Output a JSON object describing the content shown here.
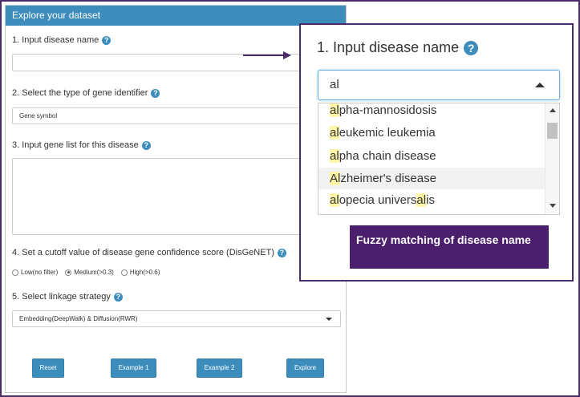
{
  "panel": {
    "header": "Explore your dataset",
    "disease_label": "1. Input disease name",
    "disease_value": "",
    "identifier_label": "2. Select the type of gene identifier",
    "identifier_value": "Gene symbol",
    "genelist_label": "3. Input gene list for this disease",
    "genelist_value": "",
    "cutoff_label": "4. Set a cutoff value of disease gene confidence score (DisGeNET)",
    "cutoff_options": [
      {
        "label": "Low(no filter)",
        "checked": false
      },
      {
        "label": "Medium(>0.3)",
        "checked": true
      },
      {
        "label": "High(>0.6)",
        "checked": false
      }
    ],
    "linkage_label": "5. Select linkage strategy",
    "linkage_value": "Embedding(DeepWalk) & Diffusion(RWR)",
    "buttons": {
      "reset": "Reset",
      "example1": "Example 1",
      "example2": "Example 2",
      "explore": "Explore"
    },
    "help_glyph": "?"
  },
  "zoom": {
    "title": "1. Input disease name",
    "help_glyph": "?",
    "input_value": "al",
    "options": [
      {
        "pre": "",
        "hl": "al",
        "post": "pha-mannosidosis"
      },
      {
        "pre": "",
        "hl": "al",
        "post": "eukemic leukemia"
      },
      {
        "pre": "",
        "hl": "al",
        "post": "pha chain disease"
      },
      {
        "pre": "",
        "hl": "Al",
        "post": "zheimer's disease"
      },
      {
        "pre": "",
        "hl": "al",
        "post": "opecia univers",
        "hl2": "al",
        "post2": "is"
      }
    ]
  },
  "callout": {
    "text": "Fuzzy matching  of disease name"
  },
  "colors": {
    "primary": "#3c8dbc",
    "frame": "#4b2c6b",
    "callout_bg": "#4b1f6b",
    "highlight": "#fff6a8"
  },
  "icons": [
    "help-icon",
    "chevron-down-icon",
    "chevron-up-icon",
    "arrow-right-icon"
  ]
}
